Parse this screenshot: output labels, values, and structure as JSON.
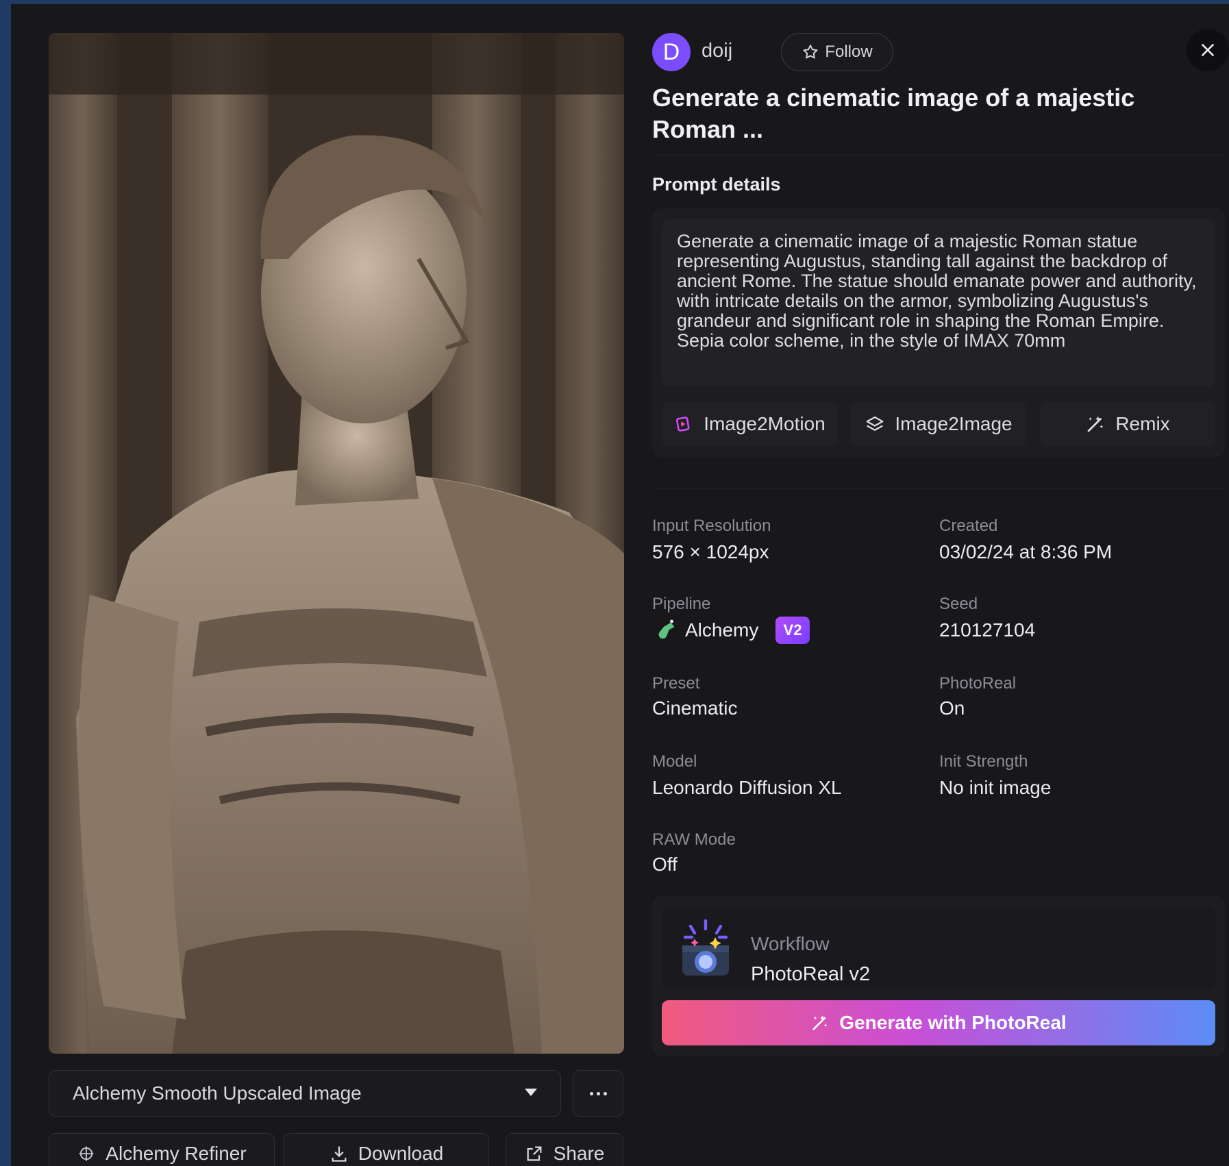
{
  "author": {
    "initial": "D",
    "username": "doij",
    "follow_label": "Follow"
  },
  "title": "Generate a cinematic image of a majestic Roman ...",
  "prompt_section": {
    "label": "Prompt details",
    "text": "Generate a cinematic image of a majestic Roman statue representing Augustus, standing tall against the backdrop of ancient Rome. The statue should emanate power and authority, with intricate details on the armor, symbolizing Augustus's grandeur and significant role in shaping the Roman Empire. Sepia color scheme, in the style of IMAX 70mm",
    "actions": [
      "Image2Motion",
      "Image2Image",
      "Remix"
    ]
  },
  "meta": {
    "input_resolution": {
      "label": "Input Resolution",
      "value": "576 × 1024px"
    },
    "created": {
      "label": "Created",
      "value": "03/02/24 at 8:36 PM"
    },
    "pipeline": {
      "label": "Pipeline",
      "value": "Alchemy",
      "badge": "V2"
    },
    "seed": {
      "label": "Seed",
      "value": "210127104"
    },
    "preset": {
      "label": "Preset",
      "value": "Cinematic"
    },
    "photoreal": {
      "label": "PhotoReal",
      "value": "On"
    },
    "model": {
      "label": "Model",
      "value": "Leonardo Diffusion XL"
    },
    "init_strength": {
      "label": "Init Strength",
      "value": "No init image"
    },
    "raw_mode": {
      "label": "RAW Mode",
      "value": "Off"
    }
  },
  "workflow": {
    "label": "Workflow",
    "value": "PhotoReal v2",
    "generate_label": "Generate with PhotoReal"
  },
  "image_panel": {
    "variant": "Alchemy Smooth Upscaled Image",
    "buttons": {
      "refiner": "Alchemy Refiner",
      "download": "Download",
      "share": "Share"
    }
  },
  "colors": {
    "background": "#1f3a63",
    "modal": "#18181b",
    "avatar": "#7c4dff",
    "badge": "#b04cff",
    "gradient_start": "#f05a7e",
    "gradient_end": "#5c8cf6"
  },
  "icons": [
    "star-icon",
    "close-icon",
    "image2motion-icon",
    "layers-icon",
    "magic-wand-icon",
    "alchemy-flask-icon",
    "camera-sparkle-icon",
    "dropdown-caret-icon",
    "more-icon",
    "refiner-icon",
    "download-icon",
    "share-icon"
  ]
}
